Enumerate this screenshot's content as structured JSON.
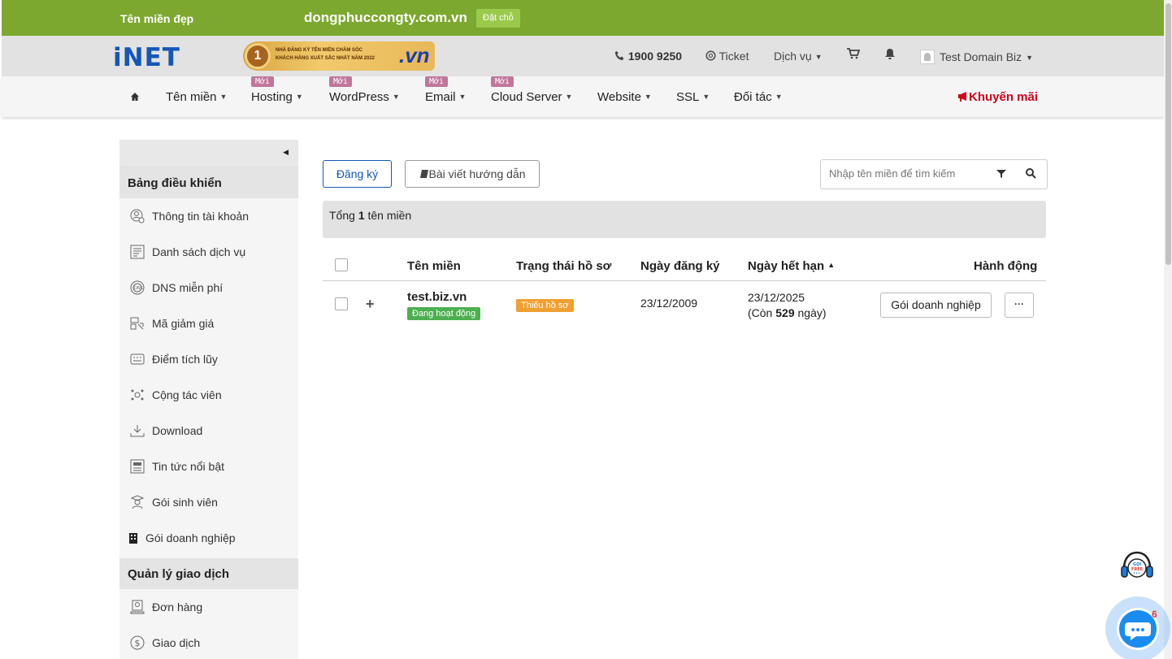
{
  "promo": {
    "label": "Tên miền đẹp",
    "domain": "dongphuccongty.com.vn",
    "reserve": "Đặt chỗ"
  },
  "header": {
    "logo": "iNET",
    "banner_line1": "NHÀ ĐĂNG KÝ TÊN MIỀN CHĂM SÓC",
    "banner_line2": "KHÁCH HÀNG XUẤT SẮC NHẤT NĂM 2022",
    "banner_rank": "1",
    "banner_vn": ".vn",
    "phone": "1900 9250",
    "ticket": "Ticket",
    "services": "Dịch vụ",
    "user": "Test Domain Biz"
  },
  "nav": {
    "new_tag": "Mới",
    "items": [
      "Tên miền",
      "Hosting",
      "WordPress",
      "Email",
      "Cloud Server",
      "Website",
      "SSL",
      "Đối tác"
    ],
    "promo": "Khuyến mãi"
  },
  "sidebar": {
    "section1": "Bảng điều khiển",
    "items1": [
      "Thông tin tài khoản",
      "Danh sách dịch vụ",
      "DNS miễn phí",
      "Mã giảm giá",
      "Điểm tích lũy",
      "Cộng tác viên",
      "Download",
      "Tin tức nổi bật",
      "Gói sinh viên",
      "Gói doanh nghiệp"
    ],
    "section2": "Quản lý giao dịch",
    "items2": [
      "Đơn hàng",
      "Giao dịch"
    ]
  },
  "toolbar": {
    "register": "Đăng ký",
    "guide": "Bài viết hướng dẫn",
    "search_placeholder": "Nhập tên miền để tìm kiếm"
  },
  "summary": {
    "prefix": "Tổng",
    "count": "1",
    "suffix": "tên miền"
  },
  "table": {
    "headers": [
      "Tên miền",
      "Trạng thái hồ sơ",
      "Ngày đăng ký",
      "Ngày hết hạn",
      "Hành động"
    ],
    "row": {
      "domain": "test.biz.vn",
      "status": "Đang hoạt động",
      "profile": "Thiếu hồ sơ",
      "registered": "23/12/2009",
      "expires": "23/12/2025",
      "remaining_prefix": "(Còn",
      "remaining_days": "529",
      "remaining_suffix": "ngày)",
      "action": "Gói doanh nghiệp",
      "more": "···"
    }
  },
  "widgets": {
    "call_label": "GỌI FREE",
    "chat_count": "6"
  }
}
